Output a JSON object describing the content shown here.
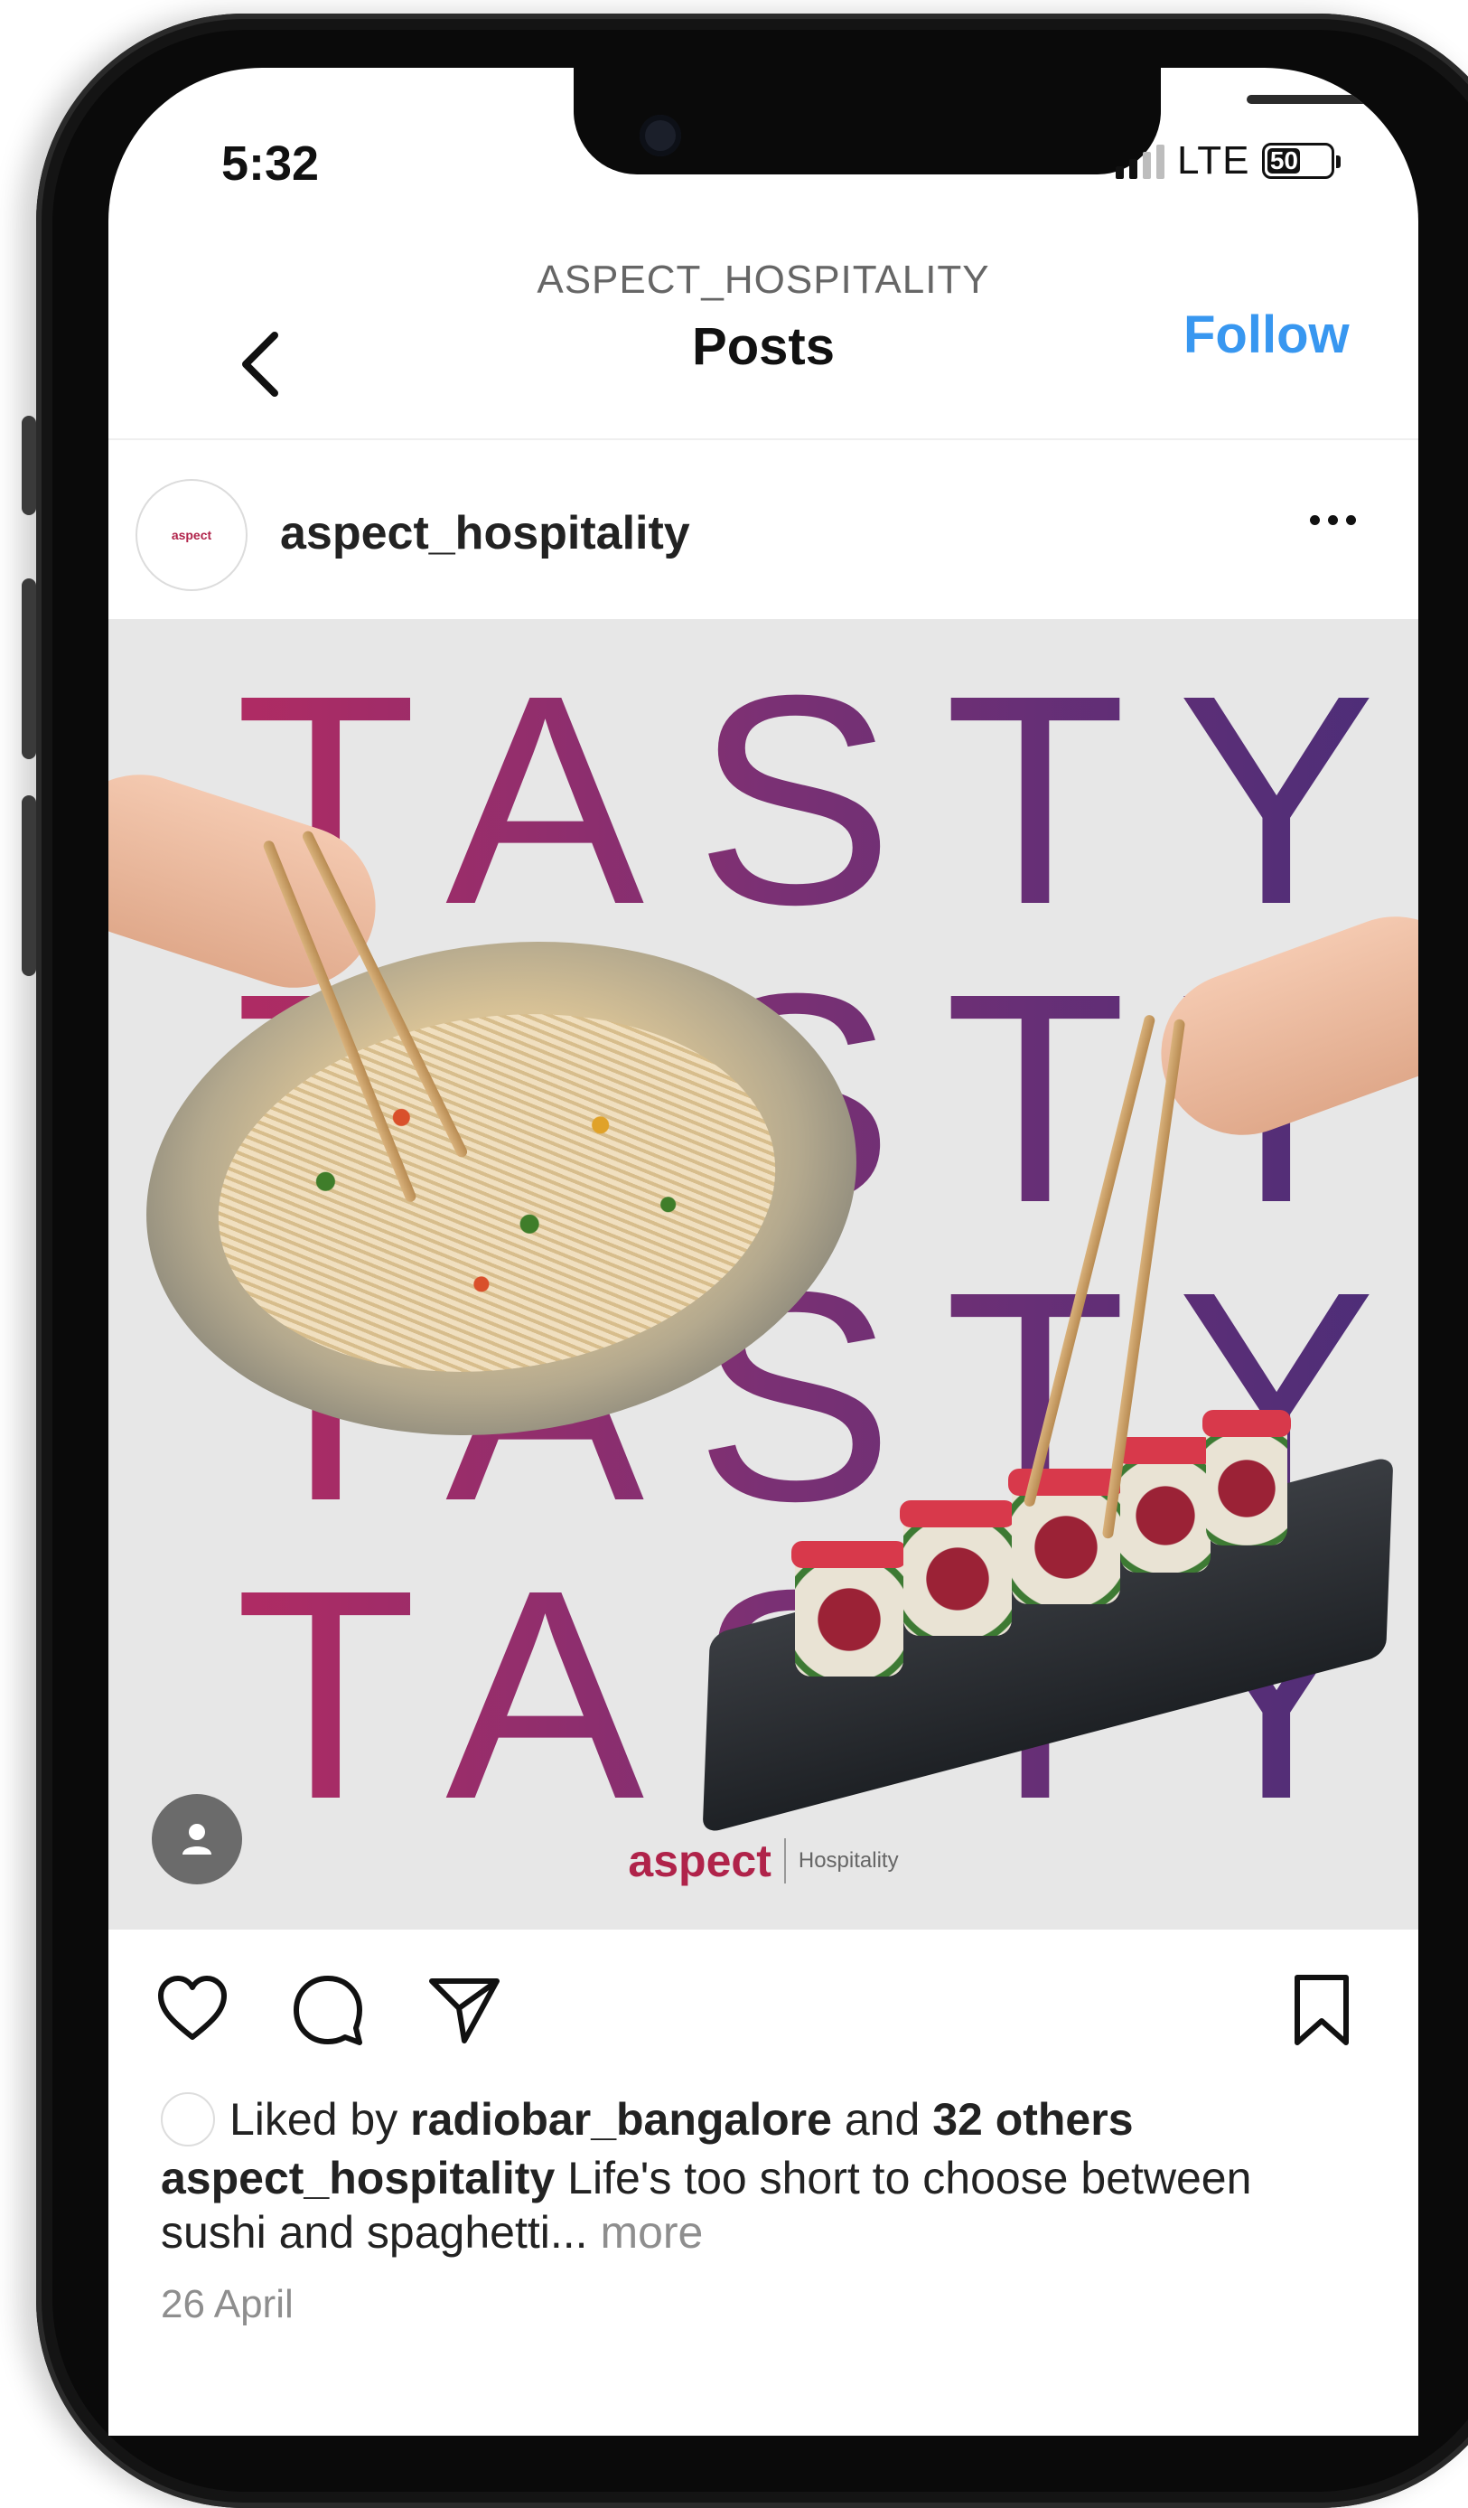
{
  "status_bar": {
    "time": "5:32",
    "network": "LTE",
    "battery": "50"
  },
  "header": {
    "account": "ASPECT_HOSPITALITY",
    "title": "Posts",
    "follow_label": "Follow",
    "back_icon": "chevron-left-icon"
  },
  "post": {
    "username": "aspect_hospitality",
    "image": {
      "headline_lines": [
        "TASTY",
        "TASTY",
        "TASTY",
        "TASTY"
      ],
      "brand_name": "aspect",
      "brand_sub": "Hospitality",
      "headline_gradient": [
        "#b02b63",
        "#7a3074",
        "#4a2d78"
      ]
    },
    "likes": {
      "prefix": "Liked by",
      "liker": "radiobar_bangalore",
      "conjunction": "and",
      "others": "32 others"
    },
    "caption": {
      "author": "aspect_hospitality",
      "text": "Life's too short to choose between sushi and spaghetti...",
      "more_label": "more"
    },
    "date": "26 April"
  },
  "actions": {
    "like_icon": "heart-icon",
    "comment_icon": "comment-icon",
    "share_icon": "send-icon",
    "save_icon": "bookmark-icon"
  },
  "colors": {
    "follow_accent": "#3897f0",
    "brand": "#b0234a"
  }
}
